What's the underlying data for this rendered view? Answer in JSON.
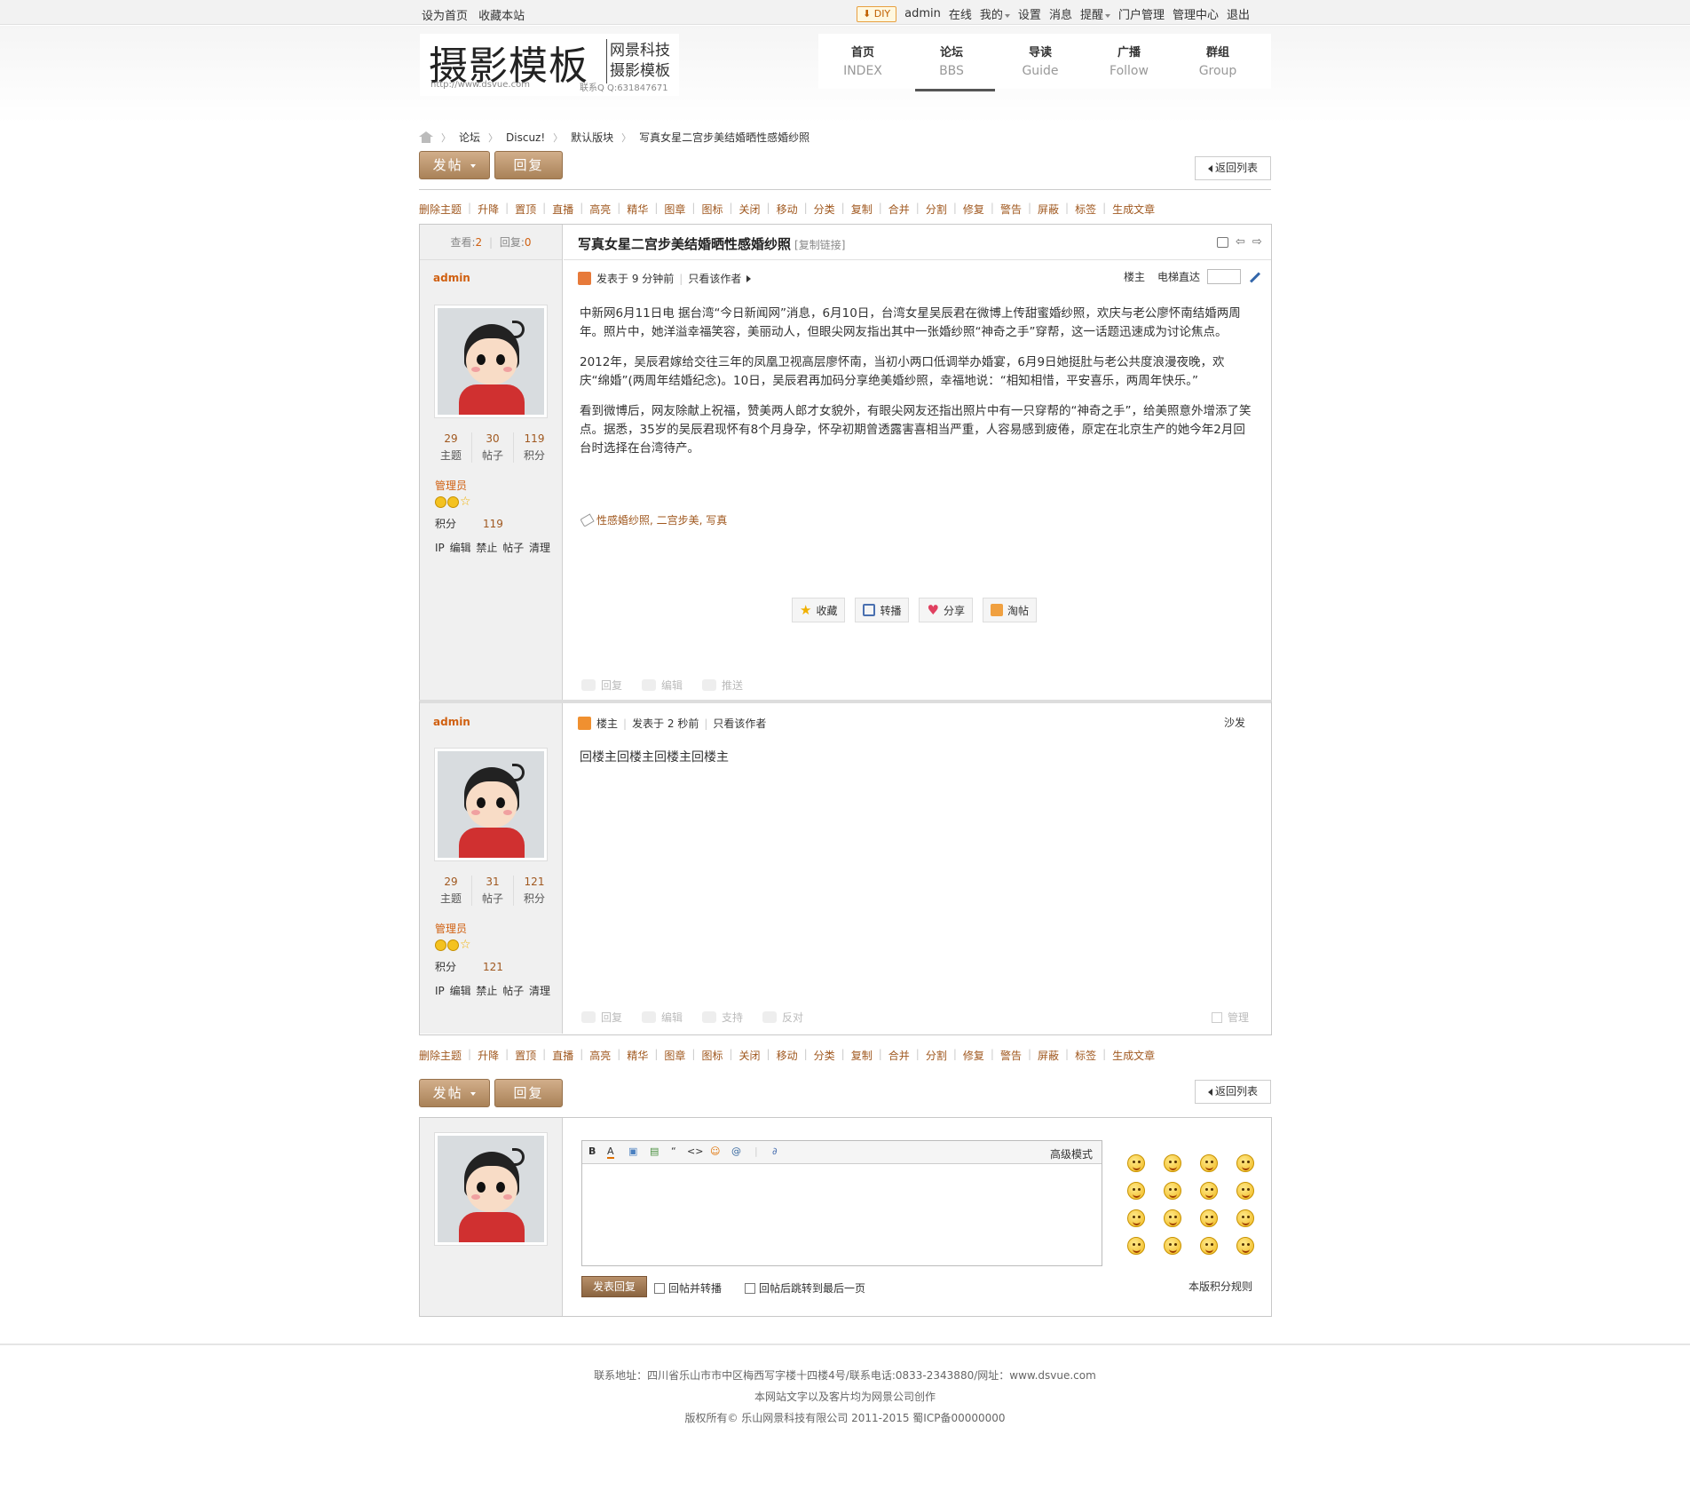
{
  "topbar": {
    "left": [
      "设为首页",
      "收藏本站"
    ],
    "diy": "DIY",
    "user": "admin",
    "links": [
      "在线",
      "我的",
      "设置",
      "消息",
      "提醒",
      "门户管理",
      "管理中心",
      "退出"
    ]
  },
  "logo": {
    "main": "摄影模板",
    "sub1": "网景科技",
    "sub2": "摄影模板",
    "url": "http://www.dsvue.com",
    "qq": "联系Q Q:631847671"
  },
  "nav": [
    {
      "cn": "首页",
      "en": "INDEX"
    },
    {
      "cn": "论坛",
      "en": "BBS"
    },
    {
      "cn": "导读",
      "en": "Guide"
    },
    {
      "cn": "广播",
      "en": "Follow"
    },
    {
      "cn": "群组",
      "en": "Group"
    }
  ],
  "breadcrumb": [
    "论坛",
    "Discuz!",
    "默认版块",
    "写真女星二宫步美结婚晒性感婚纱照"
  ],
  "buttons": {
    "post": "发帖",
    "reply": "回复",
    "back_to_list": "返回列表"
  },
  "mod_actions": [
    "删除主题",
    "升降",
    "置顶",
    "直播",
    "高亮",
    "精华",
    "图章",
    "图标",
    "关闭",
    "移动",
    "分类",
    "复制",
    "合并",
    "分割",
    "修复",
    "警告",
    "屏蔽",
    "标签",
    "生成文章"
  ],
  "thread": {
    "views_label": "查看:",
    "views": "2",
    "replies_label": "回复:",
    "replies": "0",
    "title": "写真女星二宫步美结婚晒性感婚纱照",
    "copy_link": "[复制链接]"
  },
  "posts": [
    {
      "author": "admin",
      "stats": [
        {
          "num": "29",
          "label": "主题"
        },
        {
          "num": "30",
          "label": "帖子"
        },
        {
          "num": "119",
          "label": "积分"
        }
      ],
      "role": "管理员",
      "score_label": "积分",
      "score": "119",
      "admin_links": "IP 编辑 禁止 帖子 清理",
      "posted": "发表于 9 分钟前",
      "only_author": "只看该作者",
      "floor_label": "楼主",
      "jump_label": "电梯直达",
      "paragraphs": [
        "中新网6月11日电 据台湾“今日新闻网”消息，6月10日，台湾女星吴辰君在微博上传甜蜜婚纱照，欢庆与老公廖怀南结婚两周年。照片中，她洋溢幸福笑容，美丽动人，但眼尖网友指出其中一张婚纱照“神奇之手”穿帮，这一话题迅速成为讨论焦点。",
        "2012年，吴辰君嫁给交往三年的凤凰卫视高层廖怀南，当初小两口低调举办婚宴，6月9日她挺肚与老公共度浪漫夜晚，欢庆“绵婚”(两周年结婚纪念)。10日，吴辰君再加码分享绝美婚纱照，幸福地说：“相知相惜，平安喜乐，两周年快乐。”",
        "看到微博后，网友除献上祝福，赞美两人郎才女貌外，有眼尖网友还指出照片中有一只穿帮的“神奇之手”，给美照意外增添了笑点。据悉，35岁的吴辰君现怀有8个月身孕，怀孕初期曾透露害喜相当严重，人容易感到疲倦，原定在北京生产的她今年2月回台时选择在台湾待产。"
      ],
      "tags": "性感婚纱照, 二宫步美, 写真",
      "share": [
        "收藏",
        "转播",
        "分享",
        "淘帖"
      ],
      "actions": [
        "回复",
        "编辑",
        "推送"
      ]
    },
    {
      "author": "admin",
      "stats": [
        {
          "num": "29",
          "label": "主题"
        },
        {
          "num": "31",
          "label": "帖子"
        },
        {
          "num": "121",
          "label": "积分"
        }
      ],
      "role": "管理员",
      "score_label": "积分",
      "score": "121",
      "admin_links": "IP 编辑 禁止 帖子 清理",
      "badge": "楼主",
      "posted": "发表于 2 秒前",
      "only_author": "只看该作者",
      "floor_label": "沙发",
      "text": "回楼主回楼主回楼主回楼主",
      "actions": [
        "回复",
        "编辑",
        "支持",
        "反对"
      ],
      "manage": "管理"
    }
  ],
  "editor": {
    "toolbar": [
      "B",
      "A",
      "▣",
      "▤",
      "“",
      "<>",
      "☺",
      "@",
      "∂"
    ],
    "advanced": "高级模式",
    "submit": "发表回复",
    "opt1": "回帖并转播",
    "opt2": "回帖后跳转到最后一页",
    "rules": "本版积分规则"
  },
  "footer": {
    "line1": "联系地址：四川省乐山市市中区梅西写字楼十四楼4号/联系电话:0833-2343880/网址：www.dsvue.com",
    "line2": "本网站文字以及客片均为网景公司创作",
    "line3": "版权所有©  乐山网景科技有限公司 2011-2015  蜀ICP备00000000"
  },
  "colors": {
    "accent": "#a0581f",
    "button": "#b08a64",
    "author": "#d06010"
  }
}
